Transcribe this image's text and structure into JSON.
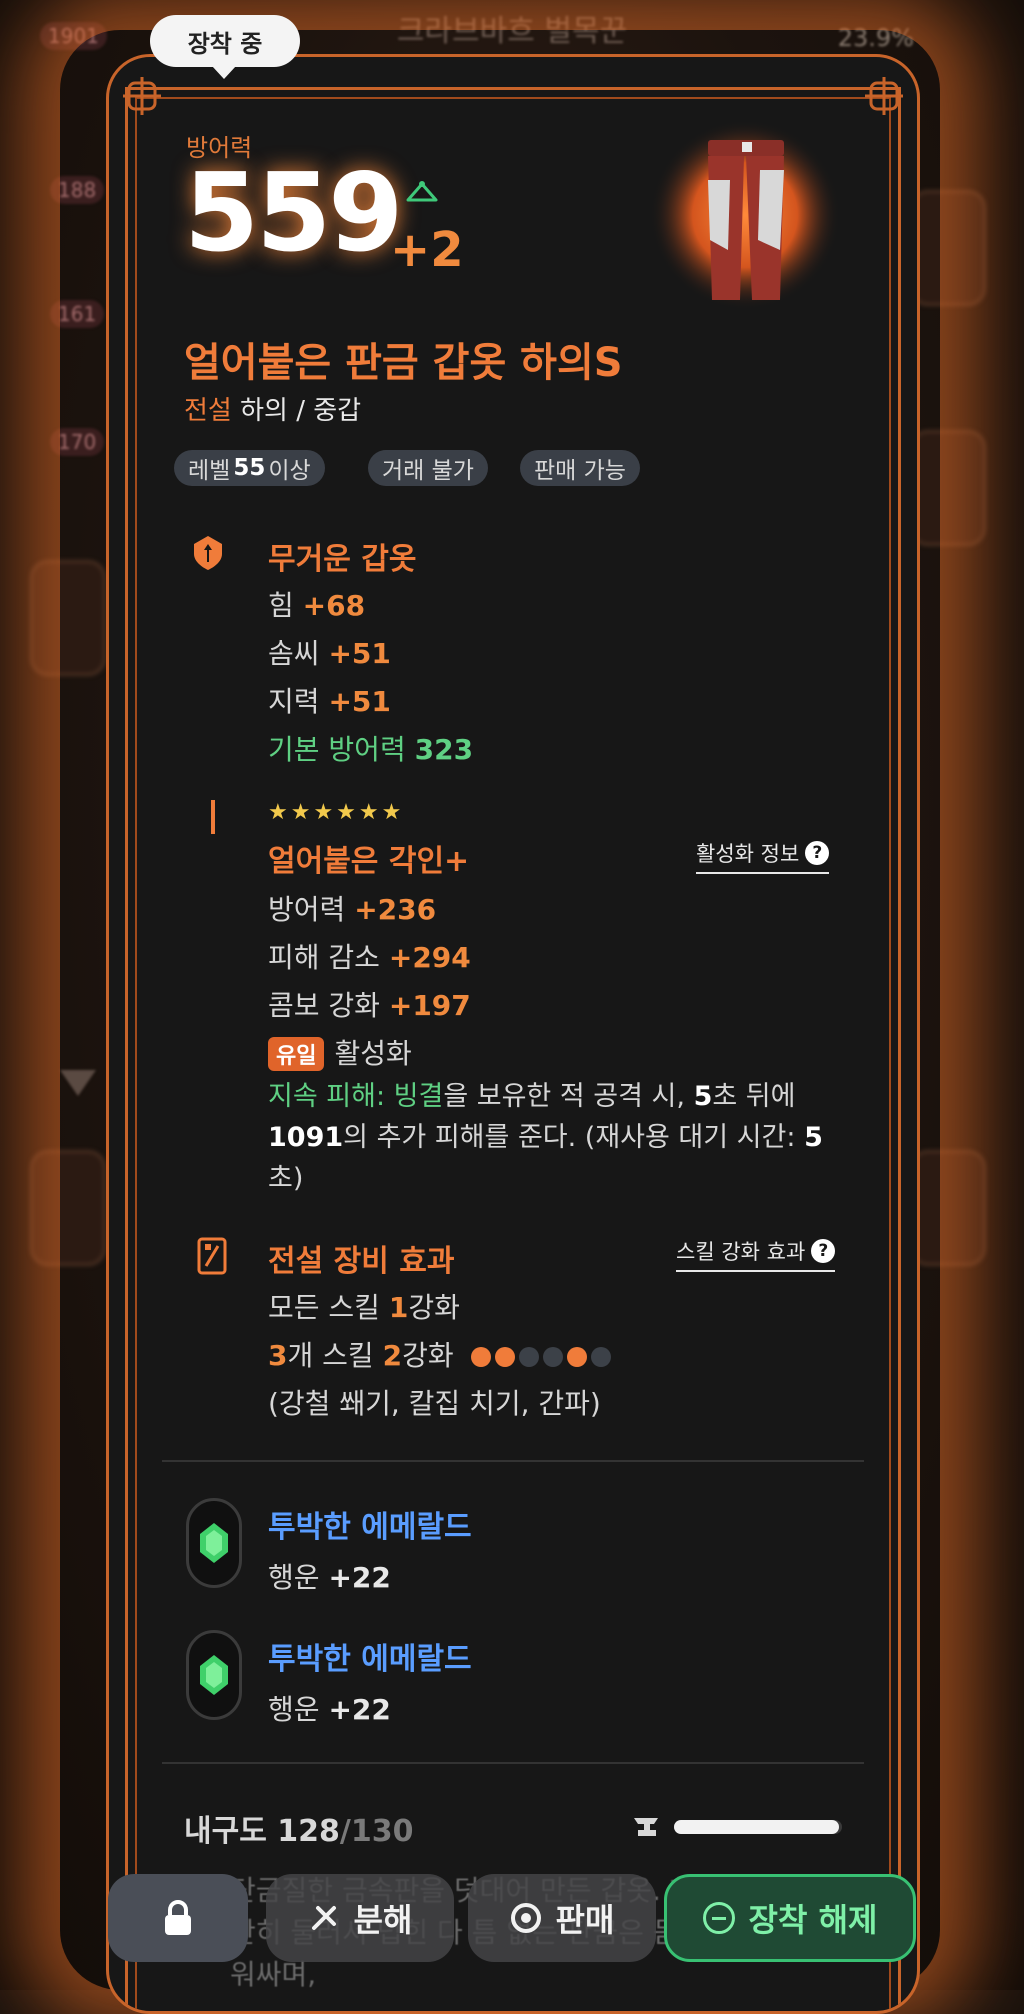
{
  "background": {
    "title": "크라브바흐 벌목꾼",
    "percent": "23.9%",
    "chips": [
      "1901",
      "188",
      "161",
      "170"
    ]
  },
  "card": {
    "equipped_badge": "장착 중",
    "defense_label": "방어력",
    "defense_value": "559",
    "defense_bonus": "+2",
    "item_name": "얼어붙은 판금 갑옷 하의S",
    "grade": "전설",
    "type": "하의 / 중갑",
    "tags": {
      "level_prefix": "레벨",
      "level_value": "55",
      "level_suffix": "이상",
      "trade": "거래 불가",
      "sell": "판매 가능"
    },
    "base": {
      "title": "무거운 갑옷",
      "stats": [
        {
          "name": "힘",
          "value": "+68"
        },
        {
          "name": "솜씨",
          "value": "+51"
        },
        {
          "name": "지력",
          "value": "+51"
        }
      ],
      "base_defense_label": "기본 방어력",
      "base_defense_value": "323"
    },
    "engraving": {
      "stars": "★★★★★★",
      "title": "얼어붙은 각인+",
      "info_link": "활성화 정보",
      "stats": [
        {
          "name": "방어력",
          "value": "+236"
        },
        {
          "name": "피해 감소",
          "value": "+294"
        },
        {
          "name": "콤보 강화",
          "value": "+197"
        }
      ],
      "unique_badge": "유일",
      "activation": "활성화",
      "desc_label": "지속 피해:",
      "desc_keyword": "빙결",
      "desc_1": "을 보유한 적 공격 시,",
      "desc_sec": "5",
      "desc_2": "초 뒤에",
      "desc_dmg": "1091",
      "desc_3": "의 추가 피해를 준다. (재사용 대기 시간:",
      "desc_cd": "5",
      "desc_4": "초)"
    },
    "legend_effect": {
      "title": "전설 장비 효과",
      "info_link": "스킬 강화 효과",
      "line1_prefix": "모든 스킬",
      "line1_value": "1",
      "line1_suffix": "강화",
      "line2_count": "3",
      "line2_mid": "개 스킬",
      "line2_value": "2",
      "line2_suffix": "강화",
      "skills": "(강철 쐐기, 칼집 치기, 간파)"
    },
    "gems": [
      {
        "name": "투박한 에메랄드",
        "stat": "행운",
        "value": "+22"
      },
      {
        "name": "투박한 에메랄드",
        "stat": "행운",
        "value": "+22"
      }
    ],
    "durability": {
      "label": "내구도",
      "current": "128",
      "max": "/130",
      "fill_fraction": 0.985
    },
    "flavor": "단금질한 금속판을 덧대어 만든 갑옷. 한 판금을 단단히 둘러서 덥힌 다 틈 없는 판금은 몸을 면밀히 에워싸며,"
  },
  "actions": {
    "disassemble": "분해",
    "sell": "판매",
    "unequip": "장착 해제"
  },
  "colors": {
    "accent": "#f07c3a",
    "green": "#5fd083",
    "blue": "#5a9dff",
    "unequip_green": "#38c173"
  }
}
